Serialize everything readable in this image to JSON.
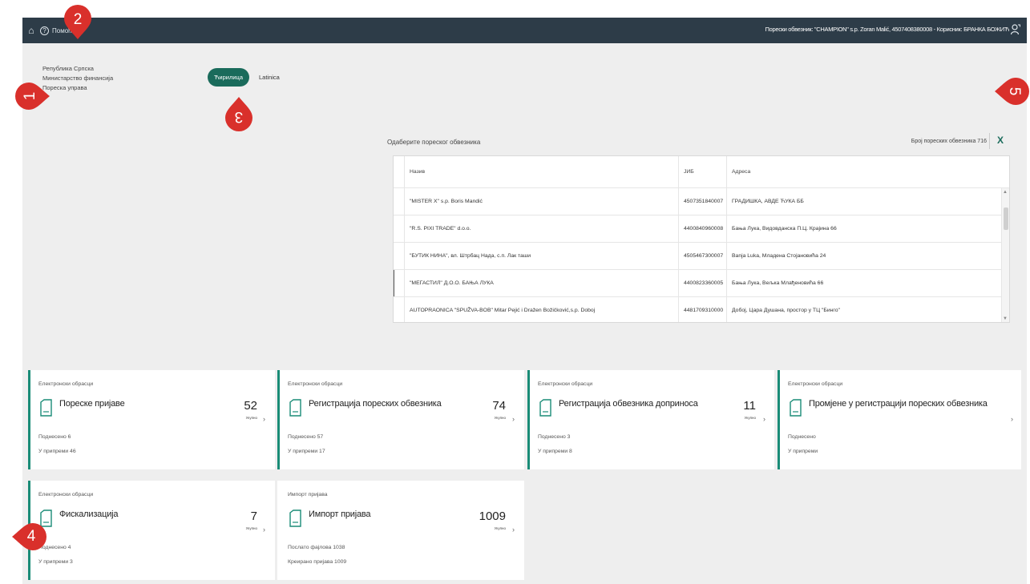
{
  "topbar": {
    "help_label": "Помоћ",
    "user_info": "Порески обвезник: \"CHAMPION\" s.p. Zoran Malić, 4507408380008 - Корисник: БРАНКА БОЖИЋ"
  },
  "org": {
    "line1": "Република Српска",
    "line2": "Министарство финансија",
    "line3": "Пореска управа"
  },
  "lang": {
    "cyrillic": "Ћирилица",
    "latin": "Latinica"
  },
  "picker": {
    "title": "Одаберите пореског обвезника",
    "count": "Број пореских обвезника 716",
    "close": "X",
    "columns": {
      "name": "Назив",
      "jib": "ЈИБ",
      "address": "Адреса"
    },
    "rows": [
      {
        "name": "\"MISTER X\" s.p. Boris Mandić",
        "jib": "4507351840007",
        "address": "ГРАДИШКА, АВДЕ ЋУКА ББ"
      },
      {
        "name": "\"R.S. PIXI TRADE\" d.o.o.",
        "jib": "4400840960008",
        "address": "Бања Лука, Видовданска П.Ц. Крајина 66"
      },
      {
        "name": "\"БУТИК НИНА\", вл. Штрбац Нада, с.п. Лак таши",
        "jib": "4505467300007",
        "address": "Banja Luka, Младена Стојановића 24"
      },
      {
        "name": "\"МЕГАСТИЛ\" Д.О.О. БАЊА ЛУКА",
        "jib": "4400823360005",
        "address": "Бања Лука, Вељка Млађеновића 66"
      },
      {
        "name": "AUTOPRAONICA \"SPUŽVA-BOB\" Mitar Pejić i Dražen Božičković,s.p. Doboj",
        "jib": "4481709310000",
        "address": "Добој, Цара Душана, простор у ТЦ \"Бинго\""
      }
    ]
  },
  "cards": [
    {
      "category": "Електронски обрасци",
      "title": "Пореске пријаве",
      "count": "52",
      "unit": "Укупно",
      "line1": "Поднесено 6",
      "line2": "У припреми 46"
    },
    {
      "category": "Електронски обрасци",
      "title": "Регистрација пореских обвезника",
      "count": "74",
      "unit": "Укупно",
      "line1": "Поднесено 57",
      "line2": "У припреми 17"
    },
    {
      "category": "Електронски обрасци",
      "title": "Регистрација обвезника доприноса",
      "count": "11",
      "unit": "Укупно",
      "line1": "Поднесено 3",
      "line2": "У припреми 8"
    },
    {
      "category": "Електронски обрасци",
      "title": "Промјене у регистрацији пореских обвезника",
      "count": "",
      "unit": "",
      "line1": "Поднесено",
      "line2": "У припреми"
    },
    {
      "category": "Електронски обрасци",
      "title": "Фискализација",
      "count": "7",
      "unit": "Укупно",
      "line1": "Поднесено 4",
      "line2": "У припреми 3"
    },
    {
      "category": "Импорт пријава",
      "title": "Импорт пријава",
      "count": "1009",
      "unit": "Укупно",
      "line1": "Послато фајлова 1038",
      "line2": "Креирано пријава 1009"
    }
  ],
  "markers": [
    "1",
    "2",
    "3",
    "4",
    "5"
  ],
  "colors": {
    "topbar": "#2d3c48",
    "accent": "#1a6b5b",
    "marker": "#d9302b"
  }
}
